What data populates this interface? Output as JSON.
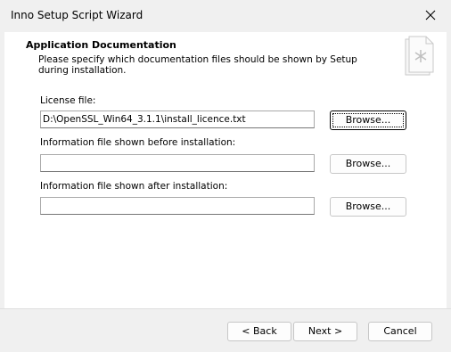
{
  "window": {
    "title": "Inno Setup Script Wizard"
  },
  "header": {
    "title": "Application Documentation",
    "description": "Please specify which documentation files should be shown by Setup during installation.",
    "icon": "document-wizard-icon"
  },
  "fields": [
    {
      "label": "License file:",
      "value": "D:\\OpenSSL_Win64_3.1.1\\install_licence.txt",
      "button": "Browse..."
    },
    {
      "label": "Information file shown before installation:",
      "value": "",
      "button": "Browse..."
    },
    {
      "label": "Information file shown after installation:",
      "value": "",
      "button": "Browse..."
    }
  ],
  "footer": {
    "back": "< Back",
    "next": "Next >",
    "cancel": "Cancel"
  }
}
